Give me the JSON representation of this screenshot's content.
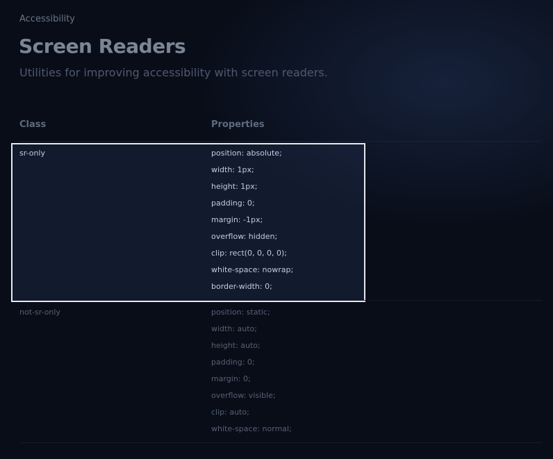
{
  "header": {
    "section": "Accessibility",
    "title": "Screen Readers",
    "description": "Utilities for improving accessibility with screen readers."
  },
  "table": {
    "columns": [
      "Class",
      "Properties"
    ],
    "rows": [
      {
        "class": "sr-only",
        "highlighted": true,
        "properties": [
          "position: absolute;",
          "width: 1px;",
          "height: 1px;",
          "padding: 0;",
          "margin: -1px;",
          "overflow: hidden;",
          "clip: rect(0, 0, 0, 0);",
          "white-space: nowrap;",
          "border-width: 0;"
        ]
      },
      {
        "class": "not-sr-only",
        "highlighted": false,
        "properties": [
          "position: static;",
          "width: auto;",
          "height: auto;",
          "padding: 0;",
          "margin: 0;",
          "overflow: visible;",
          "clip: auto;",
          "white-space: normal;"
        ]
      }
    ]
  },
  "colors": {
    "background": "#080d18",
    "highlight_border": "#e6e9ef",
    "highlight_text": "#c3cce0",
    "dim_text": "#566074"
  }
}
